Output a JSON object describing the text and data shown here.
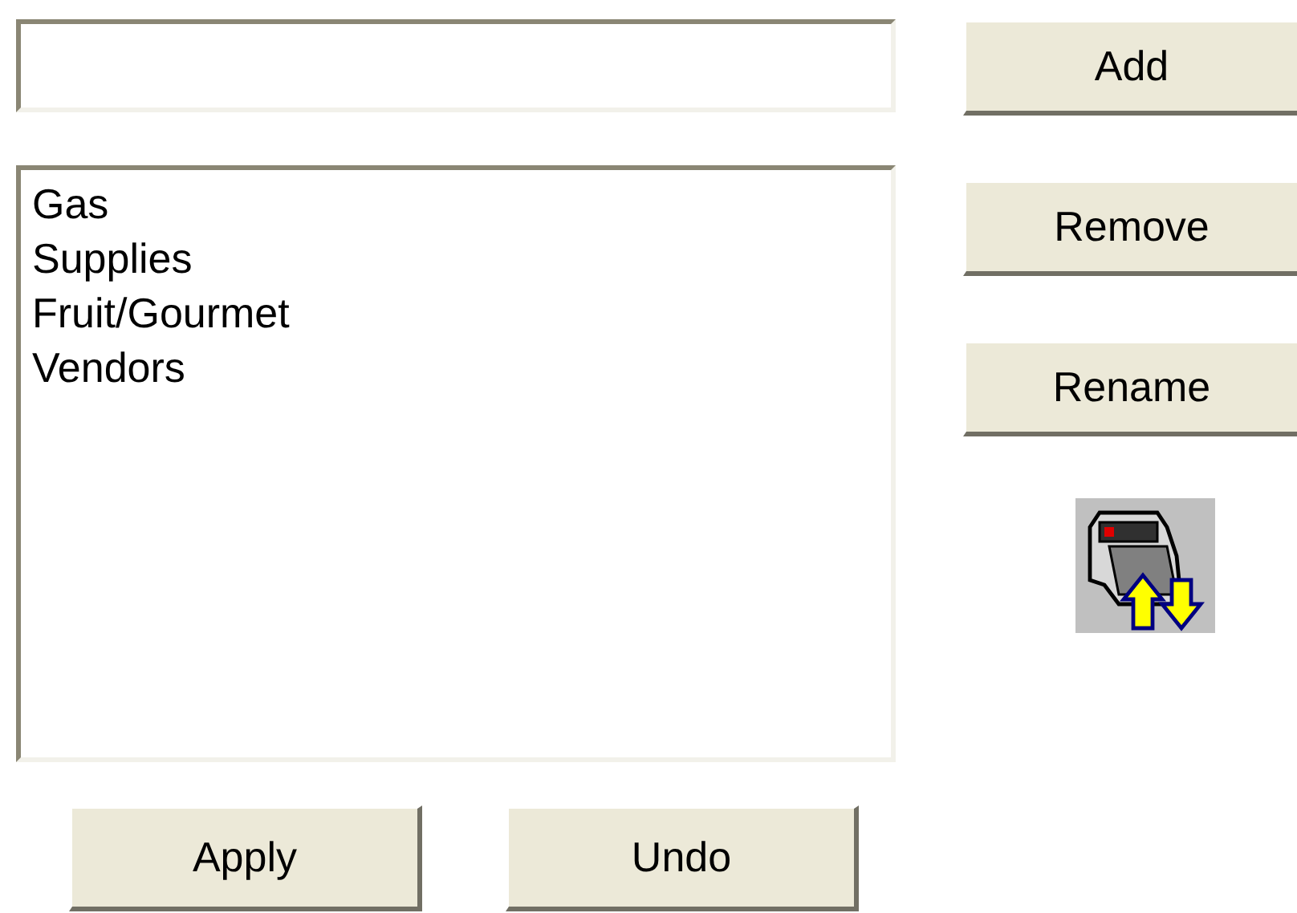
{
  "list": {
    "items": [
      {
        "label": "Gas",
        "selected": false
      },
      {
        "label": "Supplies",
        "selected": false
      },
      {
        "label": "Fruit/Gourmet",
        "selected": false
      },
      {
        "label": "Vendors",
        "selected": false
      }
    ]
  },
  "side_buttons": [
    "Add",
    "Remove",
    "Rename"
  ],
  "bottom_buttons": [
    "Apply",
    "Undo"
  ]
}
